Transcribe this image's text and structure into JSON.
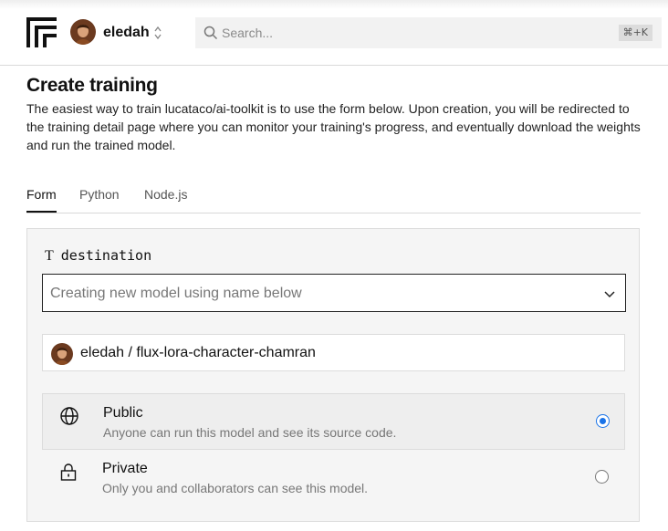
{
  "header": {
    "user_name": "eledah",
    "search_placeholder": "Search...",
    "search_shortcut": "⌘+K"
  },
  "page": {
    "title": "Create training",
    "intro": "The easiest way to train lucataco/ai-toolkit is to use the form below. Upon creation, you will be redirected to the training detail page where you can monitor your training's progress, and eventually download the weights and run the trained model."
  },
  "tabs": [
    {
      "label": "Form",
      "active": true
    },
    {
      "label": "Python",
      "active": false
    },
    {
      "label": "Node.js",
      "active": false
    }
  ],
  "form": {
    "destination_label": "destination",
    "destination_type_icon": "T",
    "destination_value": "Creating new model using name below",
    "model_owner": "eledah",
    "model_separator": "/",
    "model_name": "flux-lora-character-chamran",
    "visibility": [
      {
        "title": "Public",
        "description": "Anyone can run this model and see its source code.",
        "icon": "globe-icon",
        "selected": true
      },
      {
        "title": "Private",
        "description": "Only you and collaborators can see this model.",
        "icon": "lock-icon",
        "selected": false
      }
    ]
  },
  "colors": {
    "accent": "#1a73e8",
    "panel_bg": "#f5f5f5"
  }
}
